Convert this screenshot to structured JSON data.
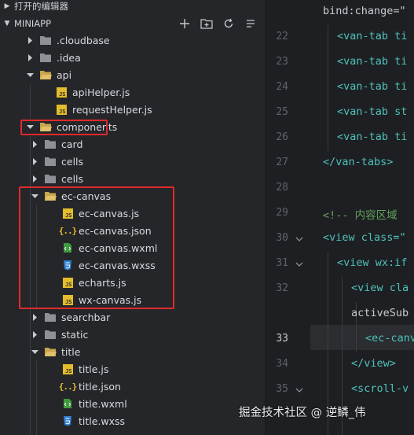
{
  "sidebar": {
    "open_editors_label": "打开的编辑器",
    "project_label": "MINIAPP",
    "actions": [
      "new-file-icon",
      "new-folder-icon",
      "refresh-icon",
      "collapse-all-icon"
    ],
    "tree": [
      {
        "label": ".cloudbase",
        "kind": "folder",
        "expanded": false
      },
      {
        "label": ".idea",
        "kind": "folder",
        "expanded": false
      },
      {
        "label": "api",
        "kind": "folder",
        "expanded": true
      },
      {
        "label": "apiHelper.js",
        "kind": "js"
      },
      {
        "label": "requestHelper.js",
        "kind": "js"
      },
      {
        "label": "components",
        "kind": "folder",
        "expanded": true
      },
      {
        "label": "card",
        "kind": "folder",
        "expanded": false
      },
      {
        "label": "cells",
        "kind": "folder",
        "expanded": false
      },
      {
        "label": "cells",
        "kind": "folder",
        "expanded": false
      },
      {
        "label": "ec-canvas",
        "kind": "folder",
        "expanded": true
      },
      {
        "label": "ec-canvas.js",
        "kind": "js"
      },
      {
        "label": "ec-canvas.json",
        "kind": "json"
      },
      {
        "label": "ec-canvas.wxml",
        "kind": "wxml"
      },
      {
        "label": "ec-canvas.wxss",
        "kind": "wxss"
      },
      {
        "label": "echarts.js",
        "kind": "js"
      },
      {
        "label": "wx-canvas.js",
        "kind": "js"
      },
      {
        "label": "searchbar",
        "kind": "folder",
        "expanded": false
      },
      {
        "label": "static",
        "kind": "folder",
        "expanded": false
      },
      {
        "label": "title",
        "kind": "folder",
        "expanded": true
      },
      {
        "label": "title.js",
        "kind": "js"
      },
      {
        "label": "title.json",
        "kind": "json"
      },
      {
        "label": "title.wxml",
        "kind": "wxml"
      },
      {
        "label": "title.wxss",
        "kind": "wxss"
      }
    ]
  },
  "editor": {
    "lines": [
      {
        "num": "",
        "text": "bind:change=\""
      },
      {
        "num": "22",
        "text": "<van-tab ti"
      },
      {
        "num": "23",
        "text": "<van-tab ti"
      },
      {
        "num": "24",
        "text": "<van-tab ti"
      },
      {
        "num": "25",
        "text": "<van-tab st"
      },
      {
        "num": "26",
        "text": "<van-tab ti"
      },
      {
        "num": "27",
        "text": "</van-tabs>"
      },
      {
        "num": "28",
        "text": ""
      },
      {
        "num": "29",
        "text": "<!-- 内容区域"
      },
      {
        "num": "30",
        "text": "<view class=\""
      },
      {
        "num": "31",
        "text": "<view wx:if"
      },
      {
        "num": "32",
        "text": "<view cla"
      },
      {
        "num": "",
        "text": "activeSub"
      },
      {
        "num": "33",
        "text": "<ec-canv"
      },
      {
        "num": "34",
        "text": "</view>"
      },
      {
        "num": "35",
        "text": "<scroll-v"
      }
    ],
    "active_line": "33"
  },
  "watermark": "掘金技术社区 @ 逆鳞_伟"
}
